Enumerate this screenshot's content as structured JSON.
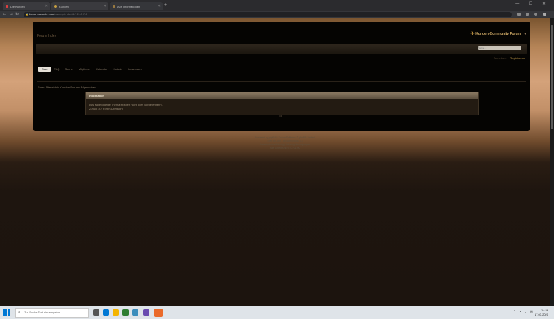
{
  "browser": {
    "tabs": [
      {
        "title": "Die Kunden"
      },
      {
        "title": "Kunden"
      },
      {
        "title": "Alle Informationen"
      }
    ],
    "new_tab": "+",
    "window_controls": "— ☐ ✕",
    "address": {
      "host": "forum.example.com",
      "path": "/viewtopic.php?f=2&t=1024"
    }
  },
  "site": {
    "name": "Forum Index",
    "brand": "Kunden-Community Forum",
    "search_placeholder": "Suche…",
    "login": "Anmelden",
    "register": "Registrieren",
    "nav": [
      "Start",
      "FAQ",
      "Suche",
      "Mitglieder",
      "Kalender",
      "Kontakt",
      "Impressum"
    ],
    "breadcrumb": "Foren-Übersicht › Kunden-Forum › Allgemeines",
    "box": {
      "title": "Information",
      "line1": "Das angeforderte Thema existiert nicht oder wurde entfernt.",
      "line2": "Zurück zur Foren-Übersicht"
    },
    "separator": "•••",
    "footer": [
      "Powered by phpBB® Forum Software © phpBB Limited",
      "Style by Arty - Update phpBB 3.3",
      "Datenschutzerklärung | Nutzungsbedingungen",
      "Alle Zeiten sind UTC+01:00"
    ]
  },
  "taskbar": {
    "search_placeholder": "Zur Suche Text hier eingeben",
    "clock_time": "14:36",
    "clock_date": "17.03.2021"
  }
}
